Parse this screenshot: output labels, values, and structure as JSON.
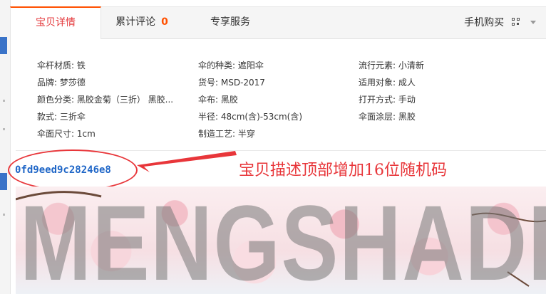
{
  "tabs": [
    {
      "label": "宝贝详情",
      "active": true
    },
    {
      "label": "累计评论",
      "count": "0"
    },
    {
      "label": "专享服务"
    }
  ],
  "mobile_buy_label": "手机购买",
  "attributes": [
    [
      "伞杆材质: 铁",
      "伞的种类: 遮阳伞",
      "流行元素: 小清新"
    ],
    [
      "品牌: 梦莎德",
      "货号: MSD-2017",
      "适用对象: 成人"
    ],
    [
      "颜色分类: 黑胶金菊（三折） 黑胶...",
      "伞布: 黑胶",
      "打开方式: 手动"
    ],
    [
      "款式: 三折伞",
      "半径: 48cm(含)-53cm(含)",
      "伞面涂层: 黑胶"
    ],
    [
      "伞面尺寸: 1cm",
      "制造工艺: 半穿",
      ""
    ]
  ],
  "random_code": "0fd9eed9c28246e8",
  "annotation": "宝贝描述顶部增加16位随机码",
  "banner_text": "MENGSHADE",
  "colors": {
    "accent": "#ff5000",
    "annotation_red": "#e8363a",
    "code_blue": "#1f66c7"
  }
}
